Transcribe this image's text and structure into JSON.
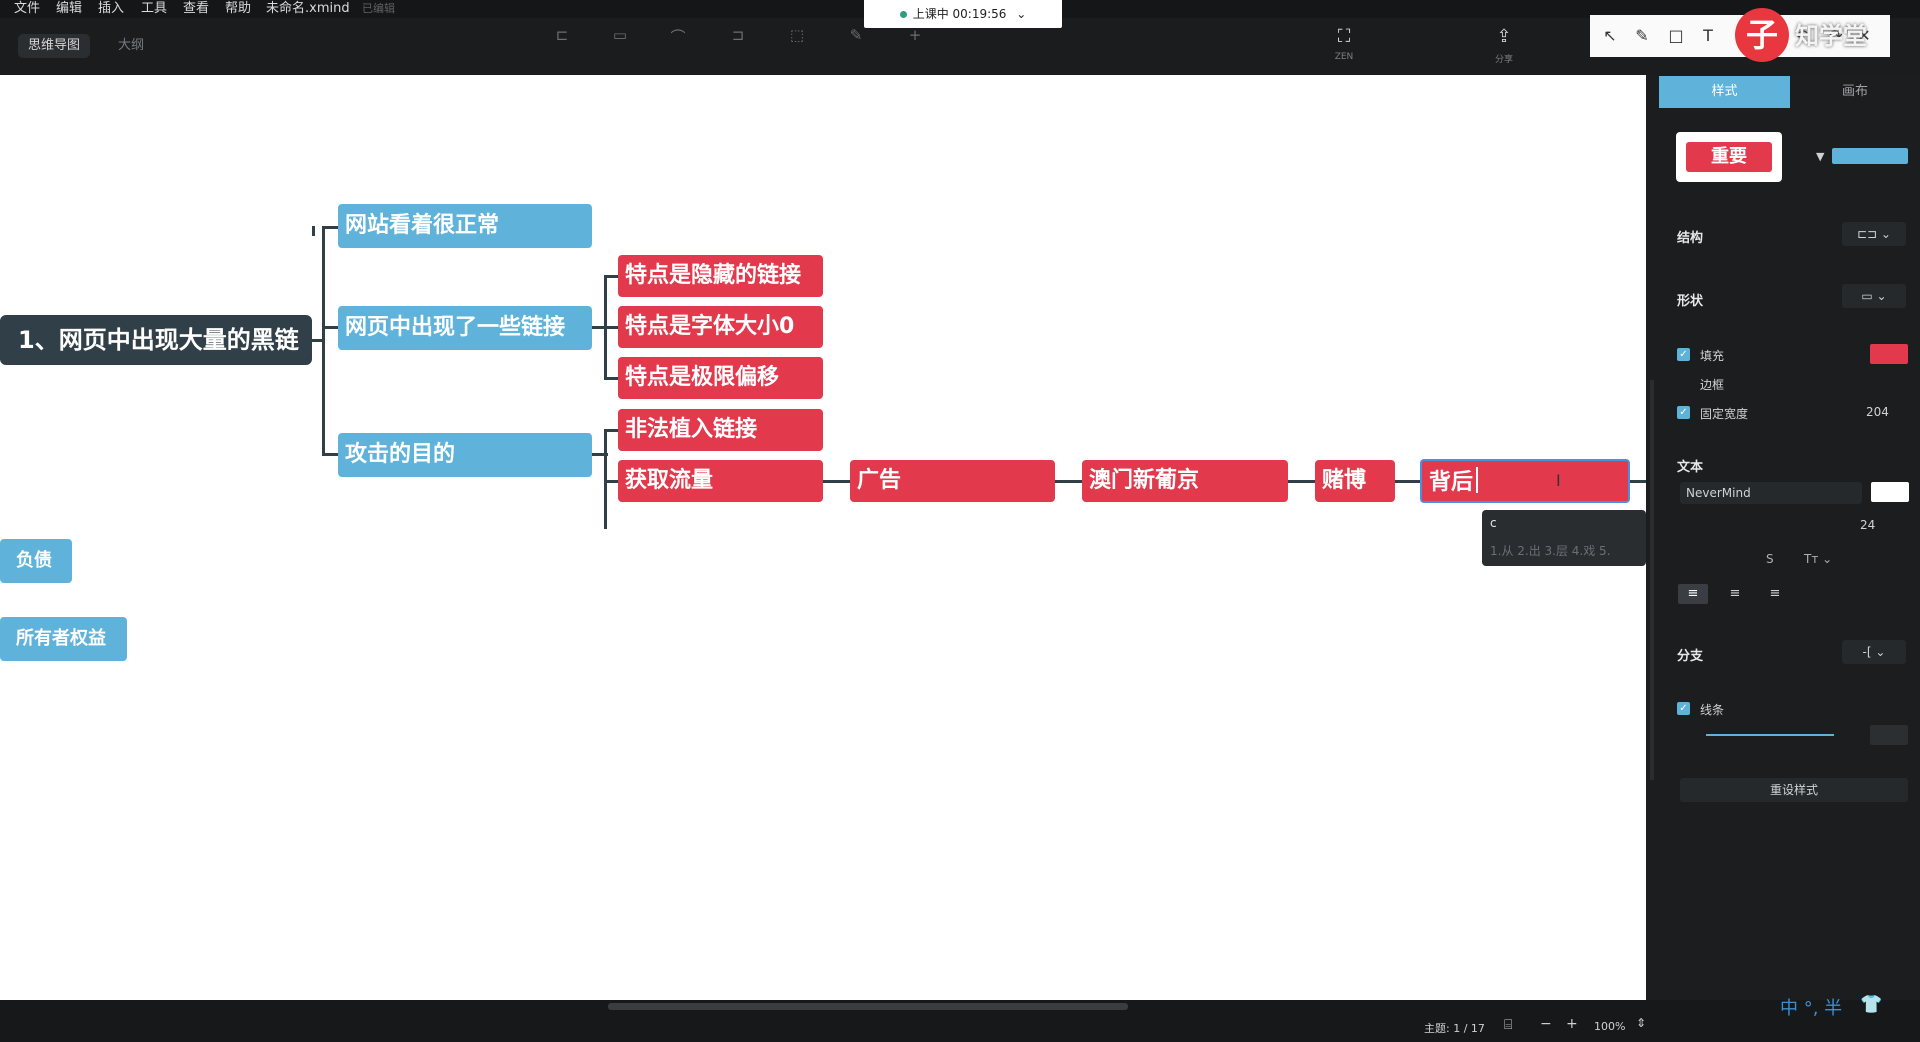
{
  "menu": {
    "file": "文件",
    "edit": "编辑",
    "insert": "插入",
    "tools": "工具",
    "view": "查看",
    "help": "帮助",
    "doc_name": "未命名.xmind",
    "saved": "已编辑"
  },
  "mode_tabs": {
    "mindmap": "思维导图",
    "outline": "大纲"
  },
  "recording": {
    "status": "上课中 00:19:56",
    "caret": "⌄"
  },
  "toolbar": {
    "zen_label": "ZEN",
    "share_label": "分享"
  },
  "logo": {
    "glyph": "子",
    "text": "知学堂"
  },
  "mindmap": {
    "root": "1、网页中出现大量的黑链",
    "n_site_normal": "网站看着很正常",
    "n_links_appear": "网页中出现了一些链接",
    "n_hidden": "特点是隐藏的链接",
    "n_font_zero": "特点是字体大小0",
    "n_offset": "特点是极限偏移",
    "n_attack_goal": "攻击的目的",
    "n_illegal": "非法植入链接",
    "n_traffic": "获取流量",
    "n_ad": "广告",
    "n_macau": "澳门新葡京",
    "n_gamble": "赌博",
    "n_behind": "背后",
    "n_debt": "负债",
    "n_equity": "所有者权益"
  },
  "popup": {
    "first": "c",
    "options": "1.从  2.出  3.层  4.戏  5."
  },
  "panel": {
    "tab_style": "样式",
    "tab_canvas": "画布",
    "preset_label": "重要",
    "structure": "结构",
    "shape": "形状",
    "fill": "填充",
    "border": "边框",
    "fixed_width": "固定宽度",
    "fixed_width_value": "204",
    "text": "文本",
    "font_name": "NeverMind",
    "font_size": "24",
    "branch": "分支",
    "line": "线条",
    "reset": "重设样式",
    "fill_color": "#e2394d"
  },
  "status": {
    "topic_count": "主题: 1 / 17",
    "zoom": "100%",
    "minus": "−",
    "plus": "+"
  },
  "ime": {
    "text": "中 °, 半"
  }
}
